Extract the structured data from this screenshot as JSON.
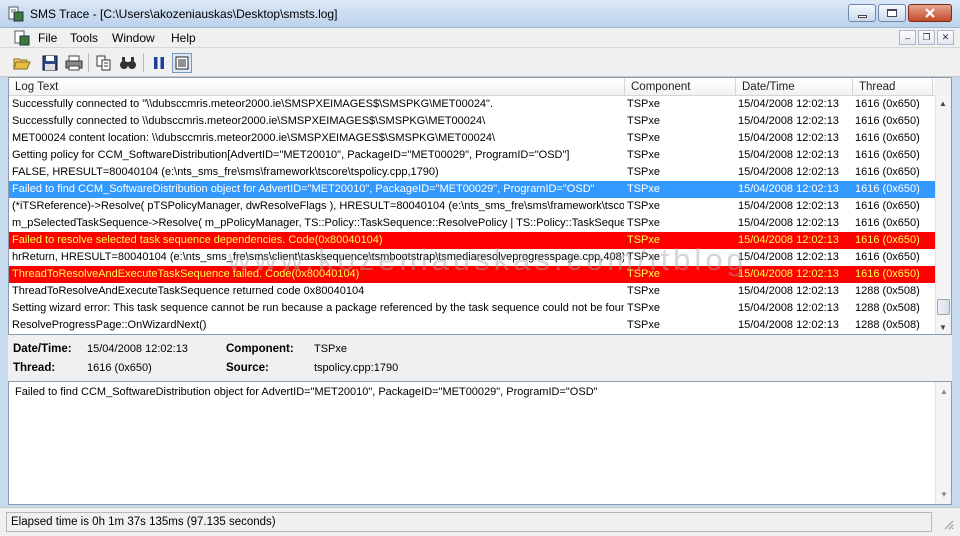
{
  "window": {
    "title": "SMS Trace - [C:\\Users\\akozeniauskas\\Desktop\\smsts.log]",
    "app_icon": "sms-trace-app-icon"
  },
  "menu": {
    "items": [
      "File",
      "Tools",
      "Window",
      "Help"
    ]
  },
  "toolbar": {
    "icons": [
      "open-folder-icon",
      "save-icon",
      "print-icon",
      "copy-icon",
      "find-icon",
      "pause-icon",
      "view-toggle-icon"
    ]
  },
  "log": {
    "columns": [
      "Log Text",
      "Component",
      "Date/Time",
      "Thread"
    ],
    "rows": [
      {
        "text": "Successfully connected to \"\\\\dubsccmris.meteor2000.ie\\SMSPXEIMAGES$\\SMSPKG\\MET00024\".",
        "component": "TSPxe",
        "datetime": "15/04/2008 12:02:13",
        "thread": "1616 (0x650)",
        "state": "normal"
      },
      {
        "text": "Successfully connected to \\\\dubsccmris.meteor2000.ie\\SMSPXEIMAGES$\\SMSPKG\\MET00024\\",
        "component": "TSPxe",
        "datetime": "15/04/2008 12:02:13",
        "thread": "1616 (0x650)",
        "state": "normal"
      },
      {
        "text": "MET00024 content location: \\\\dubsccmris.meteor2000.ie\\SMSPXEIMAGES$\\SMSPKG\\MET00024\\",
        "component": "TSPxe",
        "datetime": "15/04/2008 12:02:13",
        "thread": "1616 (0x650)",
        "state": "normal"
      },
      {
        "text": "Getting policy for CCM_SoftwareDistribution[AdvertID=\"MET20010\", PackageID=\"MET00029\", ProgramID=\"OSD\"]",
        "component": "TSPxe",
        "datetime": "15/04/2008 12:02:13",
        "thread": "1616 (0x650)",
        "state": "normal"
      },
      {
        "text": "FALSE, HRESULT=80040104 (e:\\nts_sms_fre\\sms\\framework\\tscore\\tspolicy.cpp,1790)",
        "component": "TSPxe",
        "datetime": "15/04/2008 12:02:13",
        "thread": "1616 (0x650)",
        "state": "normal"
      },
      {
        "text": "Failed to find CCM_SoftwareDistribution object for AdvertID=\"MET20010\", PackageID=\"MET00029\", ProgramID=\"OSD\"",
        "component": "TSPxe",
        "datetime": "15/04/2008 12:02:13",
        "thread": "1616 (0x650)",
        "state": "selected"
      },
      {
        "text": "(*iTSReference)->Resolve( pTSPolicyManager, dwResolveFlags ), HRESULT=80040104 (e:\\nts_sms_fre\\sms\\framework\\tscore",
        "component": "TSPxe",
        "datetime": "15/04/2008 12:02:13",
        "thread": "1616 (0x650)",
        "state": "normal"
      },
      {
        "text": "m_pSelectedTaskSequence->Resolve( m_pPolicyManager, TS::Policy::TaskSequence::ResolvePolicy | TS::Policy::TaskSequen",
        "component": "TSPxe",
        "datetime": "15/04/2008 12:02:13",
        "thread": "1616 (0x650)",
        "state": "normal"
      },
      {
        "text": "Failed to resolve selected task sequence dependencies. Code(0x80040104)",
        "component": "TSPxe",
        "datetime": "15/04/2008 12:02:13",
        "thread": "1616 (0x650)",
        "state": "error"
      },
      {
        "text": "hrReturn, HRESULT=80040104 (e:\\nts_sms_fre\\sms\\client\\tasksequence\\tsmbootstrap\\tsmediaresolveprogresspage.cpp,408)",
        "component": "TSPxe",
        "datetime": "15/04/2008 12:02:13",
        "thread": "1616 (0x650)",
        "state": "normal"
      },
      {
        "text": "ThreadToResolveAndExecuteTaskSequence failed. Code(0x80040104)",
        "component": "TSPxe",
        "datetime": "15/04/2008 12:02:13",
        "thread": "1616 (0x650)",
        "state": "error"
      },
      {
        "text": "ThreadToResolveAndExecuteTaskSequence returned code 0x80040104",
        "component": "TSPxe",
        "datetime": "15/04/2008 12:02:13",
        "thread": "1288 (0x508)",
        "state": "normal"
      },
      {
        "text": "Setting wizard error: This task sequence cannot be run because a package referenced by the task sequence could not be found.",
        "component": "TSPxe",
        "datetime": "15/04/2008 12:02:13",
        "thread": "1288 (0x508)",
        "state": "normal"
      },
      {
        "text": "ResolveProgressPage::OnWizardNext()",
        "component": "TSPxe",
        "datetime": "15/04/2008 12:02:13",
        "thread": "1288 (0x508)",
        "state": "normal"
      }
    ]
  },
  "watermark": "www.kozeniauskas.com/itblog",
  "details": {
    "datetime_label": "Date/Time:",
    "datetime_value": "15/04/2008 12:02:13",
    "component_label": "Component:",
    "component_value": "TSPxe",
    "thread_label": "Thread:",
    "thread_value": "1616 (0x650)",
    "source_label": "Source:",
    "source_value": "tspolicy.cpp:1790"
  },
  "message": "Failed to find CCM_SoftwareDistribution object for AdvertID=\"MET20010\", PackageID=\"MET00029\", ProgramID=\"OSD\"",
  "status": "Elapsed time is 0h 1m 37s 135ms (97.135 seconds)",
  "colors": {
    "selected_bg": "#3399ff",
    "error_bg": "#ff0000",
    "error_text": "#ffff4d"
  }
}
